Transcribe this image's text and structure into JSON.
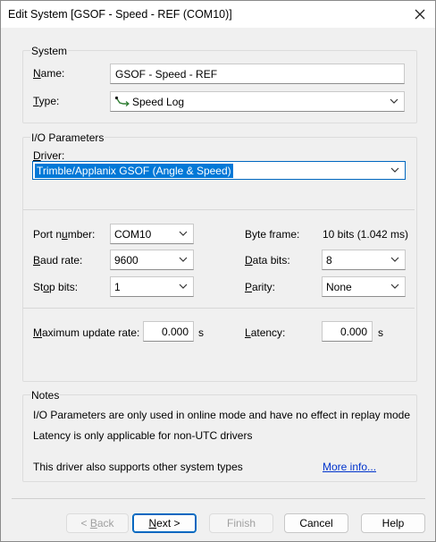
{
  "window": {
    "title": "Edit System [GSOF - Speed - REF (COM10)]"
  },
  "system": {
    "group_title": "System",
    "name_label_u": "N",
    "name_label_rest": "ame:",
    "name_value": "GSOF - Speed - REF",
    "type_label_u": "T",
    "type_label_pre": "",
    "type_label_rest": "ype:",
    "type_value": "Speed Log",
    "type_icon": "speed-log-icon"
  },
  "io": {
    "group_title": "I/O Parameters",
    "driver_label_pre": "",
    "driver_label_u": "D",
    "driver_label_rest": "river:",
    "driver_value": "Trimble/Applanix GSOF (Angle & Speed)",
    "port_label_pre": "Port n",
    "port_label_u": "u",
    "port_label_rest": "mber:",
    "port_value": "COM10",
    "byte_frame_label": "Byte frame:",
    "byte_frame_value": "10 bits (1.042 ms)",
    "baud_label_u": "B",
    "baud_label_rest": "aud rate:",
    "baud_value": "9600",
    "data_bits_label_u": "D",
    "data_bits_label_rest": "ata bits:",
    "data_bits_value": "8",
    "stop_label_pre": "St",
    "stop_label_u": "o",
    "stop_label_rest": "p bits:",
    "stop_value": "1",
    "parity_label_u": "P",
    "parity_label_rest": "arity:",
    "parity_value": "None",
    "max_rate_label_u": "M",
    "max_rate_label_rest": "aximum update rate:",
    "max_rate_value": "0.000",
    "max_rate_unit": "s",
    "latency_label_u": "L",
    "latency_label_rest": "atency:",
    "latency_value": "0.000",
    "latency_unit": "s"
  },
  "notes": {
    "group_title": "Notes",
    "line1": "I/O Parameters are only used in online mode and have no effect in replay mode",
    "line2": "Latency is only applicable for non-UTC drivers",
    "line3": "This driver also supports other system types",
    "more_info": "More info..."
  },
  "buttons": {
    "back_pre": "< ",
    "back_u": "B",
    "back_rest": "ack",
    "next_u": "N",
    "next_rest": "ext >",
    "finish": "Finish",
    "cancel": "Cancel",
    "help": "Help"
  }
}
